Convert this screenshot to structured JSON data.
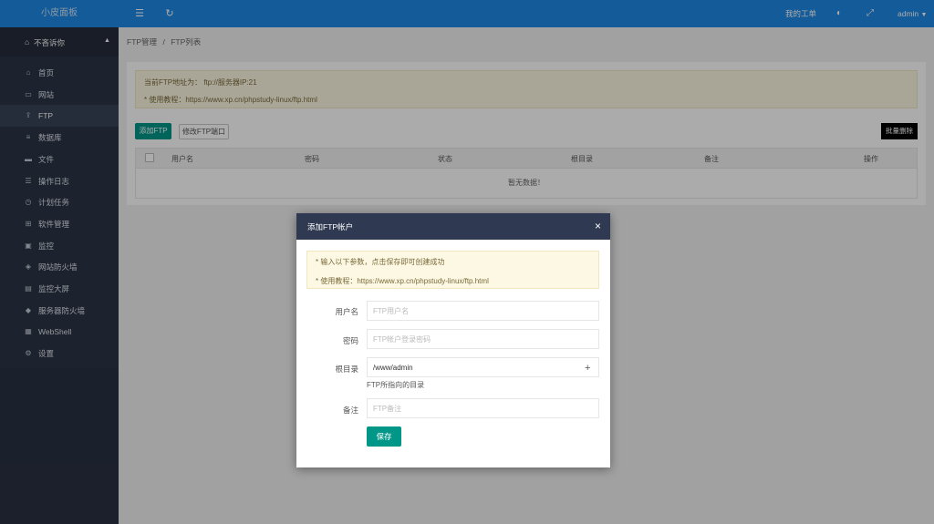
{
  "header": {
    "logo": "小皮面板",
    "my_ticket": "我的工单",
    "user": "admin"
  },
  "sidebar": {
    "user_label": "不吝诉你",
    "items": [
      {
        "icon": "home-icon",
        "glyph": "⌂",
        "label": "首页"
      },
      {
        "icon": "monitor-icon",
        "glyph": "▭",
        "label": "网站"
      },
      {
        "icon": "ftp-icon",
        "glyph": "⇪",
        "label": "FTP",
        "active": true
      },
      {
        "icon": "database-icon",
        "glyph": "≡",
        "label": "数据库"
      },
      {
        "icon": "folder-icon",
        "glyph": "▬",
        "label": "文件"
      },
      {
        "icon": "log-icon",
        "glyph": "☰",
        "label": "操作日志"
      },
      {
        "icon": "clock-icon",
        "glyph": "◷",
        "label": "计划任务"
      },
      {
        "icon": "apps-icon",
        "glyph": "⊞",
        "label": "软件管理"
      },
      {
        "icon": "monitor-chart-icon",
        "glyph": "▣",
        "label": "监控"
      },
      {
        "icon": "shield-icon",
        "glyph": "◈",
        "label": "网站防火墙"
      },
      {
        "icon": "screen-icon",
        "glyph": "▤",
        "label": "监控大屏"
      },
      {
        "icon": "server-shield-icon",
        "glyph": "◆",
        "label": "服务器防火墙"
      },
      {
        "icon": "terminal-icon",
        "glyph": "▦",
        "label": "WebShell"
      },
      {
        "icon": "gear-icon",
        "glyph": "⚙",
        "label": "设置"
      }
    ]
  },
  "breadcrumb": {
    "parent": "FTP管理",
    "sep": "/",
    "current": "FTP列表"
  },
  "notice": {
    "line1": "当前FTP地址为： ftp://服务器IP:21",
    "line2": "* 使用教程：https://www.xp.cn/phpstudy-linux/ftp.html"
  },
  "toolbar": {
    "add_ftp": "添加FTP",
    "modify_port": "修改FTP端口",
    "batch_delete": "批量删除"
  },
  "table": {
    "columns": [
      "用户名",
      "密码",
      "状态",
      "根目录",
      "备注",
      "操作"
    ],
    "empty": "暂无数据！"
  },
  "modal": {
    "title": "添加FTP帐户",
    "close": "×",
    "notice_line1": "* 输入以下参数，点击保存即可创建成功",
    "notice_line2": "* 使用教程：https://www.xp.cn/phpstudy-linux/ftp.html",
    "username_label": "用户名",
    "username_placeholder": "FTP用户名",
    "password_label": "密码",
    "password_placeholder": "FTP帐户登录密码",
    "rootdir_label": "根目录",
    "rootdir_value": "/www/admin",
    "rootdir_hint": "FTP所指向的目录",
    "remark_label": "备注",
    "remark_placeholder": "FTP备注",
    "save": "保存"
  }
}
